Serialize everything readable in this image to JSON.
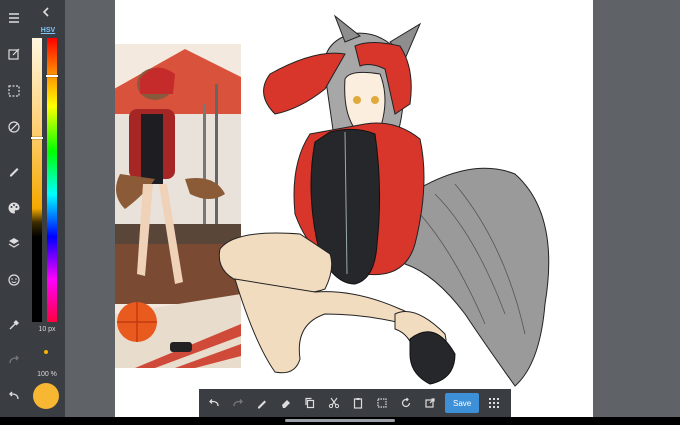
{
  "left_toolbar": {
    "items": [
      {
        "name": "menu-icon"
      },
      {
        "name": "edit-layer-icon"
      },
      {
        "name": "selection-icon"
      },
      {
        "name": "transform-icon"
      },
      {
        "name": "brush-icon"
      },
      {
        "name": "palette-icon"
      },
      {
        "name": "layers-icon"
      },
      {
        "name": "emoji-icon"
      },
      {
        "name": "eyedropper-icon"
      },
      {
        "name": "redo-icon"
      },
      {
        "name": "undo-icon"
      }
    ]
  },
  "color_panel": {
    "mode_label": "HSV",
    "brush_size": "10 px",
    "zoom": "100 %",
    "current_color": "#f7b733",
    "value_marker": 0.35,
    "hue_marker": 0.13
  },
  "bottom_toolbar": {
    "buttons": [
      {
        "name": "undo-icon"
      },
      {
        "name": "redo-icon"
      },
      {
        "name": "pencil-icon"
      },
      {
        "name": "eraser-icon"
      },
      {
        "name": "copy-icon"
      },
      {
        "name": "cut-icon"
      },
      {
        "name": "paste-icon"
      },
      {
        "name": "select-all-icon"
      },
      {
        "name": "rotate-icon"
      },
      {
        "name": "export-icon"
      }
    ],
    "save_label": "Save",
    "grid_icon": "grid-icon"
  },
  "colors": {
    "panel_bg": "#3a3d42",
    "page_bg": "#5f6368",
    "accent": "#3d8fd8",
    "hsv_label": "#7ec8ff"
  }
}
